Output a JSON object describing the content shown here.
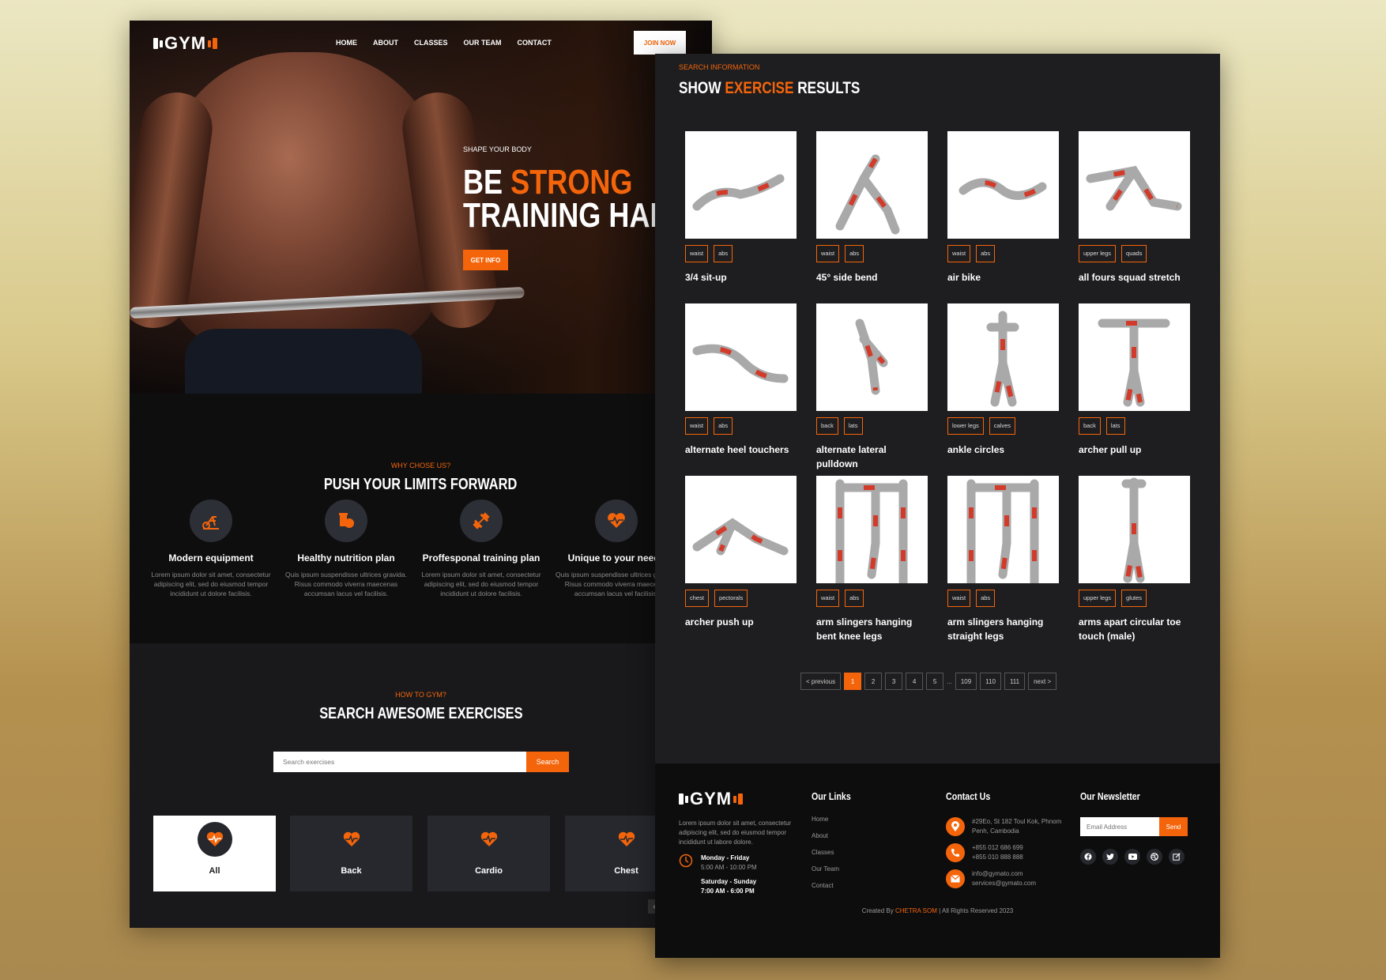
{
  "brand": {
    "logo_text": "GYM",
    "accent": "#f4650b"
  },
  "left_page": {
    "nav": {
      "items": [
        "HOME",
        "ABOUT",
        "CLASSES",
        "OUR TEAM",
        "CONTACT"
      ],
      "cta": "JOIN NOW"
    },
    "hero": {
      "kicker": "SHAPE YOUR BODY",
      "line1_a": "BE",
      "line1_b": "STRONG",
      "line2": "TRAINING HARD",
      "button": "GET INFO"
    },
    "why": {
      "kicker": "WHY CHOSE US?",
      "title": "PUSH YOUR LIMITS FORWARD",
      "features": [
        {
          "icon": "exercise-bike-icon",
          "title": "Modern equipment",
          "text": "Lorem ipsum dolor sit amet, consectetur adipiscing elit, sed do eiusmod tempor incididunt ut dolore facilisis."
        },
        {
          "icon": "nutrition-icon",
          "title": "Healthy nutrition plan",
          "text": "Quis ipsum suspendisse ultrices gravida. Risus commodo viverra maecenas accumsan lacus vel facilisis."
        },
        {
          "icon": "dumbbell-icon",
          "title": "Proffesponal training plan",
          "text": "Lorem ipsum dolor sit amet, consectetur adipiscing elit, sed do eiusmod tempor incididunt ut dolore facilisis."
        },
        {
          "icon": "heartbeat-icon",
          "title": "Unique to your needs",
          "text": "Quis ipsum suspendisse ultrices gravida. Risus commodo viverra maecenas accumsan lacus vel facilisis."
        }
      ]
    },
    "search": {
      "kicker": "HOW TO GYM?",
      "title": "SEARCH AWESOME EXERCISES",
      "placeholder": "Search exercises",
      "button": "Search",
      "categories": [
        "All",
        "Back",
        "Cardio",
        "Chest"
      ],
      "arrow": "‹"
    }
  },
  "right_page": {
    "kicker": "SEARCH INFORMATION",
    "title_a": "SHOW",
    "title_b": "EXERCISE",
    "title_c": "RESULTS",
    "exercises": [
      {
        "name": "3/4 sit-up",
        "tags": [
          "waist",
          "abs"
        ]
      },
      {
        "name": "45° side bend",
        "tags": [
          "waist",
          "abs"
        ]
      },
      {
        "name": "air bike",
        "tags": [
          "waist",
          "abs"
        ]
      },
      {
        "name": "all fours squad stretch",
        "tags": [
          "upper legs",
          "quads"
        ]
      },
      {
        "name": "alternate heel touchers",
        "tags": [
          "waist",
          "abs"
        ]
      },
      {
        "name": "alternate lateral pulldown",
        "tags": [
          "back",
          "lats"
        ]
      },
      {
        "name": "ankle circles",
        "tags": [
          "lower legs",
          "calves"
        ]
      },
      {
        "name": "archer pull up",
        "tags": [
          "back",
          "lats"
        ]
      },
      {
        "name": "archer push up",
        "tags": [
          "chest",
          "pectorals"
        ]
      },
      {
        "name": "arm slingers hanging bent knee legs",
        "tags": [
          "waist",
          "abs"
        ]
      },
      {
        "name": "arm slingers hanging straight legs",
        "tags": [
          "waist",
          "abs"
        ]
      },
      {
        "name": "arms apart circular toe touch (male)",
        "tags": [
          "upper legs",
          "glutes"
        ]
      }
    ],
    "pagination": {
      "prev": "< previous",
      "pages": [
        "1",
        "2",
        "3",
        "4",
        "5"
      ],
      "dots": "...",
      "tail": [
        "109",
        "110",
        "111"
      ],
      "next": "next >"
    },
    "footer": {
      "description": "Lorem ipsum dolor sit amet, consectetur adipiscing elit, sed do eiusmod tempor incididunt ut labore dolore.",
      "hours1_days": "Monday - Friday",
      "hours1_time": "5:00 AM - 10:00 PM",
      "hours2_days": "Saturday - Sunday",
      "hours2_time": "7:00 AM - 6:00 PM",
      "links_title": "Our Links",
      "links": [
        "Home",
        "About",
        "Classes",
        "Our Team",
        "Contact"
      ],
      "contact_title": "Contact Us",
      "address_1": "#29Eo, St 182 Toul Kok, Phnom",
      "address_2": "Penh, Cambodia",
      "phone_1": "+855 012 686 699",
      "phone_2": "+855 010 888 888",
      "email_1": "info@gymato.com",
      "email_2": "services@gymato.com",
      "newsletter_title": "Our Newsletter",
      "newsletter_placeholder": "Email Address",
      "newsletter_button": "Send",
      "copyright_a": "Created By",
      "copyright_b": "CHETRA SOM",
      "copyright_c": "| All Rights Reserved 2023"
    }
  }
}
